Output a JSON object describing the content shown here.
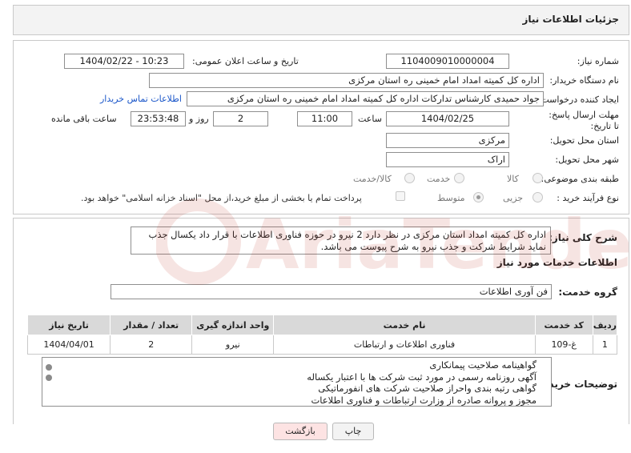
{
  "header": {
    "title": "جزئیات اطلاعات نیاز"
  },
  "labels": {
    "need_number": "شماره نیاز:",
    "announce_datetime": "تاریخ و ساعت اعلان عمومی:",
    "buyer_org": "نام دستگاه خریدار:",
    "requester": "ایجاد کننده درخواست:",
    "deadline": "مهلت ارسال پاسخ: تا تاریخ:",
    "time_word": "ساعت",
    "day_and": "روز و",
    "remaining": "ساعت باقی مانده",
    "province": "استان محل تحویل:",
    "city": "شهر محل تحویل:",
    "category": "طبقه بندی موضوعی:",
    "purchase_type": "نوع فرآیند خرید :",
    "description": "شرح کلی نیاز:",
    "services_info": "اطلاعات خدمات مورد نیاز",
    "service_group": "گروه خدمت:",
    "buyer_notes": "توضیحات خریدار:"
  },
  "fields": {
    "need_number": "1104009010000004",
    "announce_datetime": "1404/02/22 - 10:23",
    "buyer_org": "اداره کل کمیته امداد امام خمینی  ره  استان مرکزی",
    "requester": "جواد حمیدی کارشناس تدارکات اداره کل کمیته امداد امام خمینی  ره  استان مرکزی",
    "contact_link": "اطلاعات تماس خریدار",
    "deadline_date": "1404/02/25",
    "deadline_time": "11:00",
    "days": "2",
    "remaining_time": "23:53:48",
    "province": "مرکزی",
    "city": "اراک",
    "description": "اداره کل کمیته امداد استان مرکزی در نظر دارد 2 نیرو در حوزه فناوری اطلاعات با قرار داد یکسال جذب نماید شرایط شرکت و جذب نیرو به شرح پیوست می باشد.",
    "service_group": "فن آوری اطلاعات"
  },
  "category_options": [
    {
      "label": "کالا",
      "selected": false
    },
    {
      "label": "خدمت",
      "selected": false
    },
    {
      "label": "کالا/خدمت",
      "selected": false
    }
  ],
  "purchase_options": [
    {
      "label": "جزیی",
      "selected": false
    },
    {
      "label": "متوسط",
      "selected": true
    }
  ],
  "payment_note": "پرداخت تمام یا بخشی از مبلغ خرید،از محل \"اسناد خزانه اسلامی\" خواهد بود.",
  "table": {
    "headers": [
      "ردیف",
      "کد خدمت",
      "نام خدمت",
      "واحد اندازه گیری",
      "تعداد / مقدار",
      "تاریخ نیاز"
    ],
    "rows": [
      [
        "1",
        "غ-109",
        "فناوری اطلاعات و ارتباطات",
        "نیرو",
        "2",
        "1404/04/01"
      ]
    ]
  },
  "buyer_notes_lines": [
    "گواهینامه صلاحیت پیمانکاری",
    "آگهی روزنامه رسمی در مورد ثبت شرکت ها با اعتبار یکساله",
    "گواهی رتبه بندی واحراز صلاحیت شرکت های انفورماتیکی",
    "مجوز و پروانه صادره از وزارت ارتباطات و فناوری اطلاعات"
  ],
  "buttons": {
    "print": "چاپ",
    "back": "بازگشت"
  },
  "watermark_text": "AriaTender.neT",
  "colors": {
    "link": "#1a56c9",
    "back_button_bg": "#fde3e3",
    "watermark": "#c0392b"
  }
}
